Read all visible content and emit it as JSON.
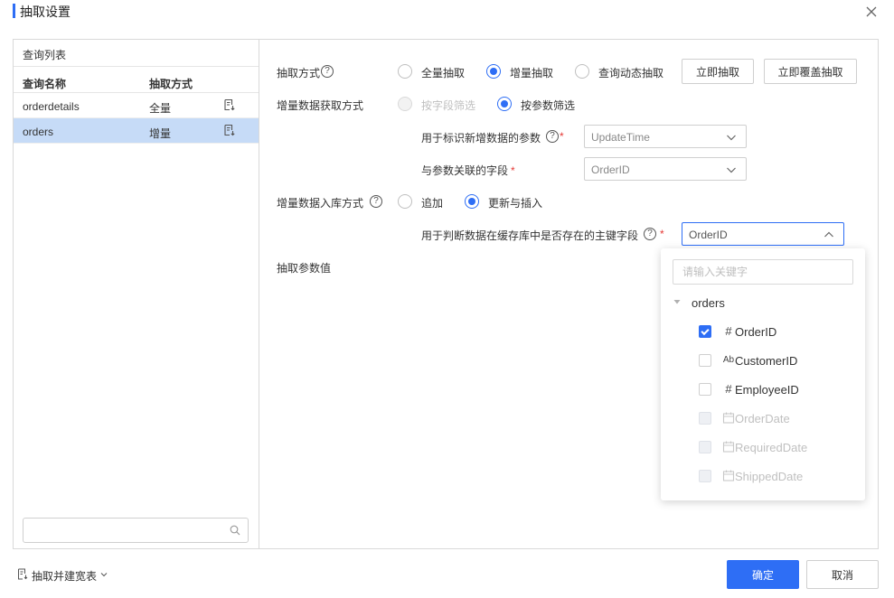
{
  "dialog": {
    "title": "抽取设置",
    "close_icon": "close-icon"
  },
  "query_list": {
    "header": "查询列表",
    "columns": [
      "查询名称",
      "抽取方式"
    ],
    "rows": [
      {
        "name": "orderdetails",
        "mode": "全量",
        "selected": false
      },
      {
        "name": "orders",
        "mode": "增量",
        "selected": true
      }
    ],
    "search_value": ""
  },
  "extract_method": {
    "label": "抽取方式",
    "options": [
      "全量抽取",
      "增量抽取",
      "查询动态抽取"
    ],
    "selected": "增量抽取",
    "buttons": [
      "立即抽取",
      "立即覆盖抽取"
    ]
  },
  "incremental_fetch": {
    "label": "增量数据获取方式",
    "options": [
      "按字段筛选",
      "按参数筛选"
    ],
    "selected": "按参数筛选",
    "disabled_option": "按字段筛选",
    "param_label": "用于标识新增数据的参数",
    "param_value": "UpdateTime",
    "field_label": "与参数关联的字段",
    "field_value": "OrderID"
  },
  "incremental_store": {
    "label": "增量数据入库方式",
    "options": [
      "追加",
      "更新与插入"
    ],
    "selected": "更新与插入",
    "pk_label": "用于判断数据在缓存库中是否存在的主键字段",
    "pk_value": "OrderID"
  },
  "extract_params": {
    "label": "抽取参数值"
  },
  "pk_dropdown": {
    "search_placeholder": "请输入关键字",
    "parent": "orders",
    "items": [
      {
        "label": "OrderID",
        "type_icon": "#",
        "checked": true,
        "disabled": false
      },
      {
        "label": "CustomerID",
        "type_icon": "Ab",
        "checked": false,
        "disabled": false
      },
      {
        "label": "EmployeeID",
        "type_icon": "#",
        "checked": false,
        "disabled": false
      },
      {
        "label": "OrderDate",
        "type_icon": "calendar-icon",
        "checked": false,
        "disabled": true
      },
      {
        "label": "RequiredDate",
        "type_icon": "calendar-icon",
        "checked": false,
        "disabled": true
      },
      {
        "label": "ShippedDate",
        "type_icon": "calendar-icon",
        "checked": false,
        "disabled": true
      }
    ]
  },
  "footer": {
    "link_label": "抽取并建宽表",
    "ok_label": "确定",
    "cancel_label": "取消"
  },
  "colors": {
    "primary": "#2e6ef5",
    "selected_row": "#c6dbf7",
    "required": "#e53935"
  }
}
